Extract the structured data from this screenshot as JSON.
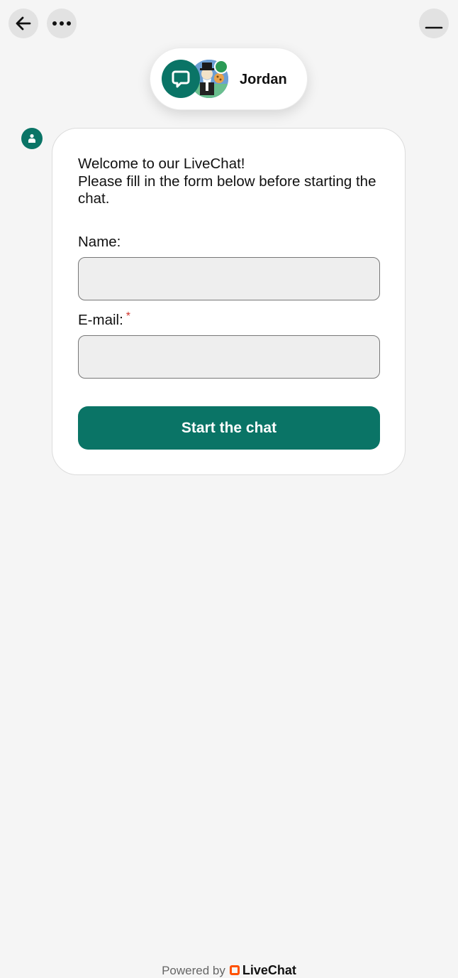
{
  "header": {
    "agent_name": "Jordan",
    "agent_status_color": "#2b9a55"
  },
  "icons": {
    "back": "arrow-left-icon",
    "more": "more-horizontal-icon",
    "minimize": "minimize-icon",
    "chat_logo": "chat-bubble-icon",
    "bot": "bot-icon"
  },
  "form": {
    "welcome_line1": "Welcome to our LiveChat!",
    "welcome_line2": "Please fill in the form below before starting the chat.",
    "name_label": "Name:",
    "name_value": "",
    "email_label": "E-mail:",
    "email_required_mark": "*",
    "email_value": "",
    "submit_label": "Start the chat"
  },
  "footer": {
    "powered_by": "Powered by",
    "brand": "LiveChat"
  },
  "colors": {
    "accent": "#0a7466",
    "background": "#f5f5f5",
    "required": "#d0342c",
    "brand_orange": "#ff5100"
  }
}
